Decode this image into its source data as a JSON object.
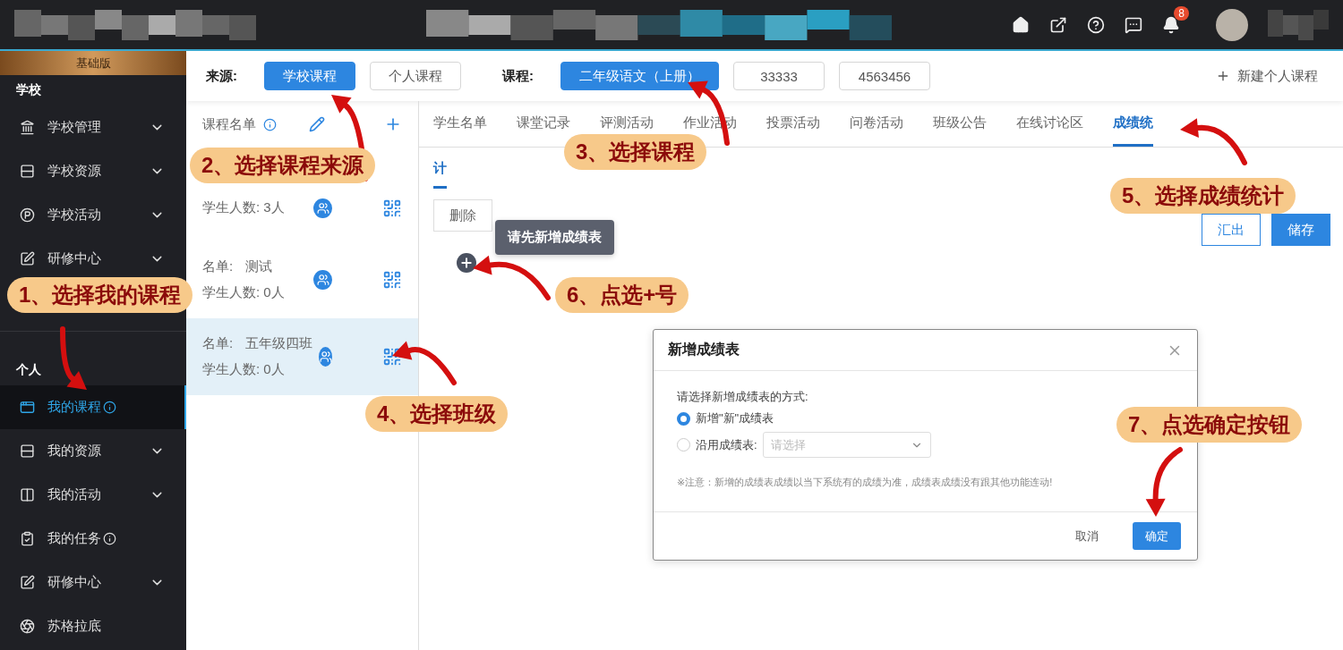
{
  "topbar": {
    "notification_count": "8"
  },
  "sidebar": {
    "edition_badge": "基础版",
    "sections": [
      {
        "title": "学校",
        "items": [
          {
            "label": "学校管理",
            "expandable": true,
            "info": false,
            "selected": false
          },
          {
            "label": "学校资源",
            "expandable": true,
            "info": false,
            "selected": false
          },
          {
            "label": "学校活动",
            "expandable": true,
            "info": false,
            "selected": false
          },
          {
            "label": "研修中心",
            "expandable": true,
            "info": false,
            "selected": false
          }
        ]
      },
      {
        "title": "个人",
        "items": [
          {
            "label": "我的课程",
            "expandable": false,
            "info": true,
            "selected": true
          },
          {
            "label": "我的资源",
            "expandable": true,
            "info": false,
            "selected": false
          },
          {
            "label": "我的活动",
            "expandable": true,
            "info": false,
            "selected": false
          },
          {
            "label": "我的任务",
            "expandable": false,
            "info": true,
            "selected": false
          },
          {
            "label": "研修中心",
            "expandable": true,
            "info": false,
            "selected": false
          },
          {
            "label": "苏格拉底",
            "expandable": false,
            "info": false,
            "selected": false
          }
        ]
      }
    ]
  },
  "source_bar": {
    "source_label": "来源:",
    "sources": [
      {
        "label": "学校课程",
        "selected": true
      },
      {
        "label": "个人课程",
        "selected": false
      }
    ],
    "course_label": "课程:",
    "courses": [
      {
        "label": "二年级语文（上册）",
        "selected": true
      },
      {
        "label": "33333",
        "selected": false
      },
      {
        "label": "4563456",
        "selected": false
      }
    ],
    "new_course": "新建个人课程"
  },
  "class_list": {
    "title": "课程名单",
    "items": [
      {
        "count": "学生人数: 3人",
        "selected": false
      },
      {
        "name_label": "名单:",
        "name": "测试",
        "count": "学生人数: 0人",
        "selected": false
      },
      {
        "name_label": "名单:",
        "name": "五年级四班",
        "count": "学生人数: 0人",
        "selected": true
      }
    ]
  },
  "tabs": [
    {
      "label": "学生名单",
      "selected": false
    },
    {
      "label": "课堂记录",
      "selected": false
    },
    {
      "label": "评测活动",
      "selected": false
    },
    {
      "label": "作业活动",
      "selected": false
    },
    {
      "label": "投票活动",
      "selected": false
    },
    {
      "label": "问卷活动",
      "selected": false
    },
    {
      "label": "班级公告",
      "selected": false
    },
    {
      "label": "在线讨论区",
      "selected": false
    },
    {
      "label": "成绩统",
      "selected": true
    }
  ],
  "subtabs": [
    {
      "label": "计",
      "selected": true
    }
  ],
  "actions": {
    "delete": "删除",
    "export": "汇出",
    "save": "储存"
  },
  "tooltip": "请先新增成绩表",
  "dialog": {
    "title": "新增成绩表",
    "prompt": "请选择新增成绩表的方式:",
    "options": [
      {
        "kind": "plain",
        "label": "新增\"新\"成绩表",
        "selected": true
      },
      {
        "kind": "select",
        "label": "沿用成绩表:",
        "placeholder": "请选择",
        "selected": false
      }
    ],
    "note": "※注意：新增的成绩表成绩以当下系统有的成绩为准，成绩表成绩没有跟其他功能连动!",
    "cancel": "取消",
    "ok": "确定"
  },
  "callouts": [
    {
      "text": "1、选择我的课程"
    },
    {
      "text": "2、选择课程来源"
    },
    {
      "text": "3、选择课程"
    },
    {
      "text": "4、选择班级"
    },
    {
      "text": "5、选择成绩统计"
    },
    {
      "text": "6、点选+号"
    },
    {
      "text": "7、点选确定按钮"
    }
  ]
}
